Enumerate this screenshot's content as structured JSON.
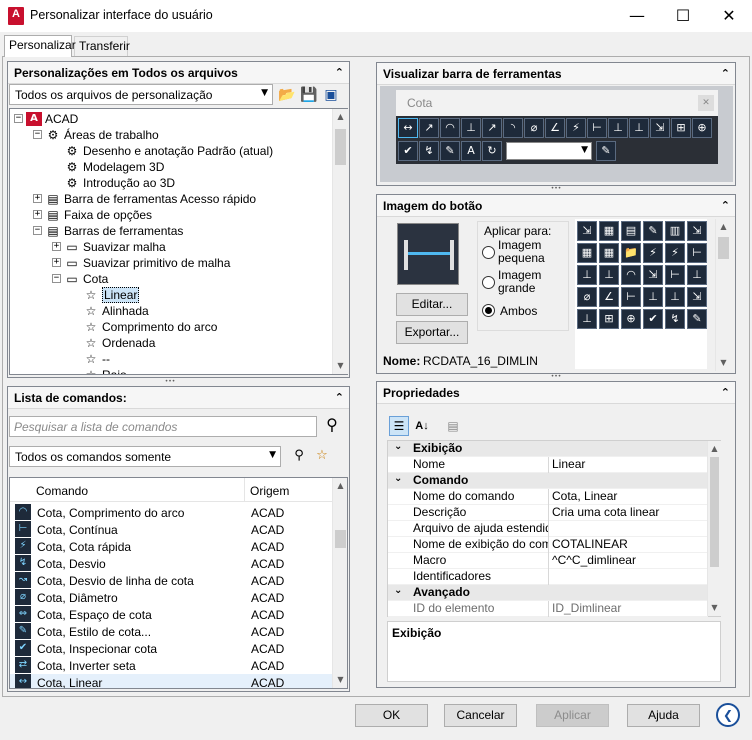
{
  "window": {
    "title": "Personalizar interface do usuário",
    "logo": "A",
    "minimize": "—",
    "maximize": "☐",
    "close": "✕"
  },
  "tabs": [
    "Personalizar",
    "Transferir"
  ],
  "custom_panel": {
    "title": "Personalizações em Todos os arquivos",
    "combo_value": "Todos os arquivos de personalização",
    "tree": [
      {
        "label": "ACAD",
        "level": 0
      },
      {
        "label": "Áreas de trabalho",
        "level": 1
      },
      {
        "label": "Desenho e anotação Padrão (atual)",
        "level": 2
      },
      {
        "label": "Modelagem 3D",
        "level": 2
      },
      {
        "label": "Introdução ao 3D",
        "level": 2
      },
      {
        "label": "Barra de ferramentas Acesso rápido",
        "level": 1
      },
      {
        "label": "Faixa de opções",
        "level": 1
      },
      {
        "label": "Barras de ferramentas",
        "level": 1
      },
      {
        "label": "Suavizar malha",
        "level": 2
      },
      {
        "label": "Suavizar primitivo de malha",
        "level": 2
      },
      {
        "label": "Cota",
        "level": 2
      },
      {
        "label": "Linear",
        "level": 3
      },
      {
        "label": "Alinhada",
        "level": 3
      },
      {
        "label": "Comprimento do arco",
        "level": 3
      },
      {
        "label": "Ordenada",
        "level": 3
      },
      {
        "label": "--",
        "level": 3
      },
      {
        "label": "Raio",
        "level": 3
      }
    ]
  },
  "command_panel": {
    "title": "Lista de comandos:",
    "search_placeholder": "Pesquisar a lista de comandos",
    "filter_value": "Todos os comandos somente",
    "col_command": "Comando",
    "col_origin": "Origem",
    "rows": [
      {
        "name": "Cota, Comprimento do arco",
        "origin": "ACAD",
        "icon": "◠"
      },
      {
        "name": "Cota, Contínua",
        "origin": "ACAD",
        "icon": "⊢"
      },
      {
        "name": "Cota, Cota rápida",
        "origin": "ACAD",
        "icon": "⚡"
      },
      {
        "name": "Cota, Desvio",
        "origin": "ACAD",
        "icon": "↯"
      },
      {
        "name": "Cota, Desvio de linha de cota",
        "origin": "ACAD",
        "icon": "↝"
      },
      {
        "name": "Cota, Diâmetro",
        "origin": "ACAD",
        "icon": "⌀"
      },
      {
        "name": "Cota, Espaço de cota",
        "origin": "ACAD",
        "icon": "⇔"
      },
      {
        "name": "Cota, Estilo de cota...",
        "origin": "ACAD",
        "icon": "✎"
      },
      {
        "name": "Cota, Inspecionar cota",
        "origin": "ACAD",
        "icon": "✔"
      },
      {
        "name": "Cota, Inverter seta",
        "origin": "ACAD",
        "icon": "⇄"
      },
      {
        "name": "Cota, Linear",
        "origin": "ACAD",
        "icon": "↔"
      }
    ]
  },
  "toolbar_preview": {
    "title": "Visualizar barra de ferramentas",
    "toolbar_name": "Cota",
    "icons_row1": [
      "↔",
      "↗",
      "◠",
      "⊥",
      "↗",
      "◝",
      "⌀",
      "∠",
      "⚡",
      "⊢",
      "⊥",
      "⊥",
      "⇲",
      "⊞",
      "⊕"
    ],
    "icons_row2": [
      "✔",
      "↯",
      "✎",
      "A",
      "↻"
    ],
    "style_value": ""
  },
  "button_image": {
    "title": "Imagem do botão",
    "apply_label": "Aplicar para:",
    "opt_small": "Imagem pequena",
    "opt_large": "Imagem grande",
    "opt_both": "Ambos",
    "edit": "Editar...",
    "export": "Exportar...",
    "name_label": "Nome:",
    "name_value": "RCDATA_16_DIMLIN",
    "icons": [
      "⇲",
      "▦",
      "▤",
      "✎",
      "▥",
      "⇲",
      "▦",
      "▦",
      "📁",
      "⚡",
      "⚡",
      "⊢",
      "⊥",
      "⊥",
      "◠",
      "⇲",
      "⊢",
      "⊥",
      "⌀",
      "∠",
      "⊢",
      "⊥",
      "⊥",
      "⇲",
      "⊥",
      "⊞",
      "⊕",
      "✔",
      "↯",
      "✎"
    ]
  },
  "properties": {
    "title": "Propriedades",
    "categories": [
      {
        "name": "Exibição",
        "rows": [
          {
            "k": "Nome",
            "v": "Linear"
          }
        ]
      },
      {
        "name": "Comando",
        "rows": [
          {
            "k": "Nome do comando",
            "v": "Cota, Linear"
          },
          {
            "k": "Descrição",
            "v": "Cria uma cota linear"
          },
          {
            "k": "Arquivo de ajuda estendida",
            "v": ""
          },
          {
            "k": "Nome de exibição do comando",
            "v": "COTALINEAR"
          },
          {
            "k": "Macro",
            "v": "^C^C_dimlinear"
          },
          {
            "k": "Identificadores",
            "v": ""
          }
        ]
      },
      {
        "name": "Avançado",
        "rows": [
          {
            "k": "ID do elemento",
            "v": "ID_Dimlinear"
          }
        ]
      }
    ],
    "desc_title": "Exibição"
  },
  "footer": {
    "ok": "OK",
    "cancel": "Cancelar",
    "apply": "Aplicar",
    "help": "Ajuda"
  }
}
